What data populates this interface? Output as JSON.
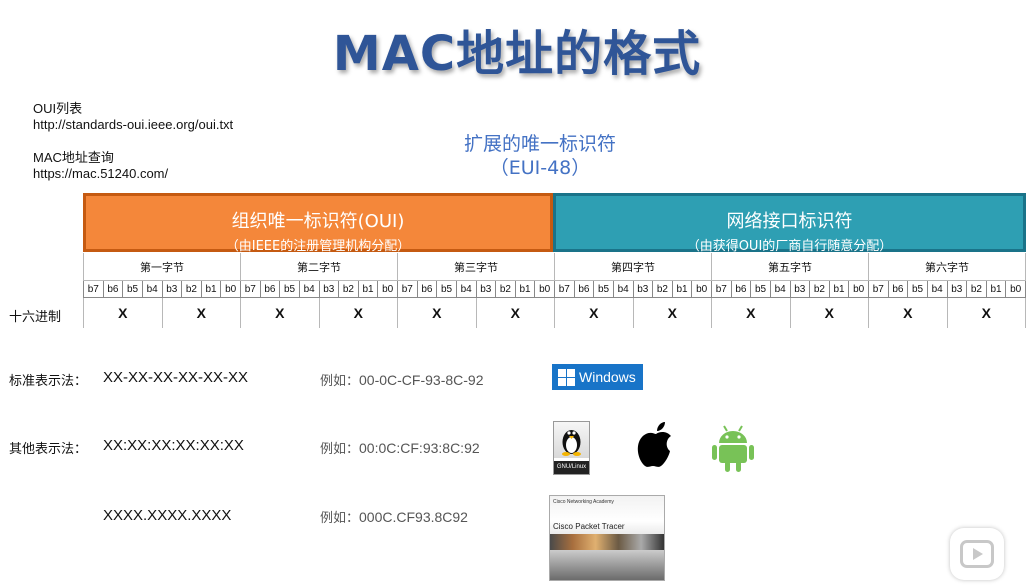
{
  "title": "MAC地址的格式",
  "oui_list": {
    "label": "OUI列表",
    "url": "http://standards-oui.ieee.org/oui.txt"
  },
  "mac_query": {
    "label": "MAC地址查询",
    "url": "https://mac.51240.com/"
  },
  "eui": {
    "line1": "扩展的唯一标识符",
    "line2": "（EUI-48）"
  },
  "bands": {
    "oui": {
      "title": "组织唯一标识符(OUI)",
      "subtitle": "（由IEEE的注册管理机构分配）"
    },
    "nic": {
      "title": "网络接口标识符",
      "subtitle": "（由获得OUI的厂商自行随意分配）"
    }
  },
  "bytes": [
    "第一字节",
    "第二字节",
    "第三字节",
    "第四字节",
    "第五字节",
    "第六字节"
  ],
  "bits": [
    "b7",
    "b6",
    "b5",
    "b4",
    "b3",
    "b2",
    "b1",
    "b0"
  ],
  "hex_label": "十六进制",
  "hex_placeholder": "X",
  "standard": {
    "label": "标准表示法：",
    "format": "XX-XX-XX-XX-XX-XX",
    "example_prefix": "例如：",
    "example": "00-0C-CF-93-8C-92"
  },
  "other": {
    "label": "其他表示法：",
    "format": "XX:XX:XX:XX:XX:XX",
    "example_prefix": "例如：",
    "example": "00:0C:CF:93:8C:92"
  },
  "cisco": {
    "format": "XXXX.XXXX.XXXX",
    "example_prefix": "例如：",
    "example": "000C.CF93.8C92"
  },
  "logos": {
    "windows": "Windows",
    "linux_footer": "GNU/Linux",
    "packet_tracer_header": "Cisco Networking Academy",
    "packet_tracer_name": "Cisco Packet Tracer"
  },
  "icons": [
    "windows-logo-icon",
    "linux-tux-icon",
    "apple-logo-icon",
    "android-robot-icon",
    "play-button-icon"
  ]
}
